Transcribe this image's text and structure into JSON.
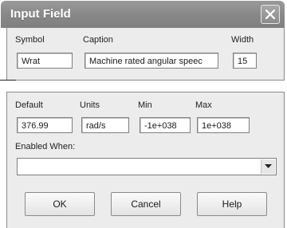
{
  "window": {
    "title": "Input Field"
  },
  "row1": {
    "symbol_label": "Symbol",
    "symbol_value": "Wrat",
    "caption_label": "Caption",
    "caption_value": "Machine rated angular speec",
    "width_label": "Width",
    "width_value": "15"
  },
  "row2": {
    "default_label": "Default",
    "default_value": "376.99",
    "units_label": "Units",
    "units_value": "rad/s",
    "min_label": "Min",
    "min_value": "-1e+038",
    "max_label": "Max",
    "max_value": "1e+038"
  },
  "enabled_when": {
    "label": "Enabled When:",
    "value": ""
  },
  "buttons": {
    "ok": "OK",
    "cancel": "Cancel",
    "help": "Help"
  },
  "icons": {
    "close": "close-icon",
    "dropdown": "chevron-down-icon"
  }
}
